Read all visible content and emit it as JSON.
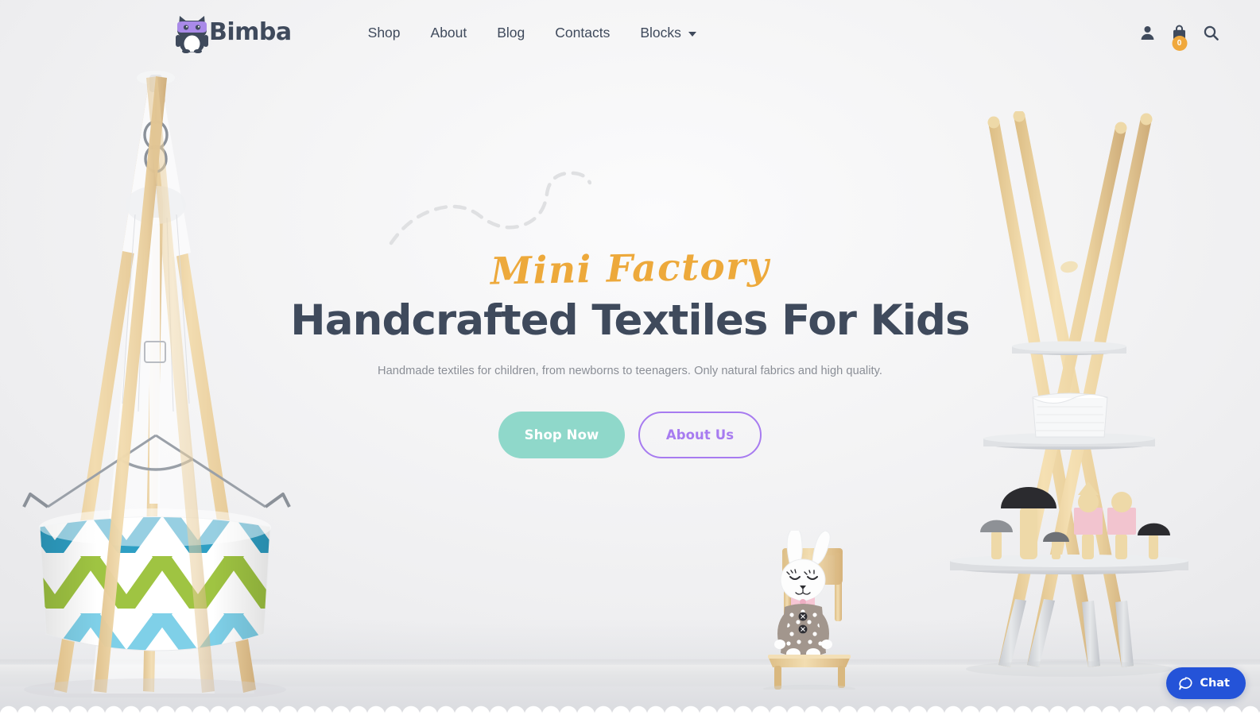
{
  "brand": {
    "name": "Bimba",
    "logo_icon": "bimba-cat-mascot-logo",
    "logo_color": "#3f4a5c",
    "logo_accent_color": "#a98ae8"
  },
  "nav": {
    "items": [
      {
        "label": "Shop",
        "has_dropdown": false
      },
      {
        "label": "About",
        "has_dropdown": false
      },
      {
        "label": "Blog",
        "has_dropdown": false
      },
      {
        "label": "Contacts",
        "has_dropdown": false
      },
      {
        "label": "Blocks",
        "has_dropdown": true
      }
    ]
  },
  "header_actions": {
    "account_icon": "user-person-icon",
    "cart_icon": "shopping-bag-icon",
    "cart_count": "0",
    "cart_badge_color": "#f0a83c",
    "search_icon": "search-magnifier-icon"
  },
  "hero": {
    "script_title": "Mini Factory",
    "script_title_color": "#eda93b",
    "main_title": "Handcrafted Textiles For Kids",
    "main_title_color": "#3f4a5c",
    "subtitle": "Handmade textiles for children, from newborns to teenagers. Only natural fabrics and high quality.",
    "subtitle_color": "#8a8e96",
    "decoration": "dashed-wavy-line",
    "primary_button": {
      "label": "Shop Now",
      "bg": "#8fd8ca",
      "text_color": "#ffffff"
    },
    "secondary_button": {
      "label": "About Us",
      "border_color": "#a77bf0",
      "text_color": "#a77bf0"
    }
  },
  "scenery": {
    "left_object": "wooden-tripod-hanging-cradle-with-chevron-fabric",
    "left_object_colors": [
      "#2e9fc4",
      "#9fc442",
      "#7fd0e8",
      "#ffffff",
      "#e4c68a"
    ],
    "center_object": "plush-bunny-on-wooden-chair",
    "right_object": "wooden-teepee-ladder-shelf-with-toys",
    "right_object_colors": [
      "#f0d9a8",
      "#d8dadd",
      "#f2c4cf",
      "#2b2b2f"
    ]
  },
  "chat_widget": {
    "label": "Chat",
    "icon": "chat-bubble-icon",
    "bg": "#2453d8",
    "text_color": "#ffffff"
  }
}
